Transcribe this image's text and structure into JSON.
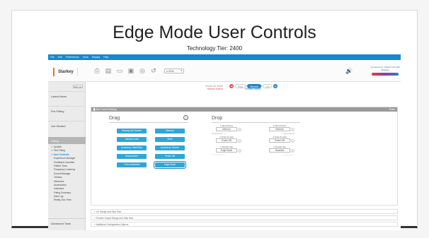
{
  "slide": {
    "title": "Edge Mode User Controls",
    "subtitle": "Technology Tier: 2400"
  },
  "menu": [
    "File",
    "Edit",
    "Preferences",
    "Tools",
    "Display",
    "Help"
  ],
  "toolbar": {
    "logo": "Starkey",
    "selector": "e-SEM",
    "connection": "Connected to: Patient  3.01 Wifi  Wireless",
    "icons": [
      "save-icon",
      "print-icon",
      "open-icon",
      "folder-icon",
      "record-icon",
      "undo-icon",
      "ear-icon",
      "music-icon"
    ]
  },
  "program": {
    "left_name": "Evolv AI 2400",
    "left_status": "Restart Switch",
    "right_name": "Evolv AI 2400",
    "right_status": "Restart Switch",
    "sides": [
      "Right",
      "Binaural",
      "Left"
    ],
    "selected_side": "Binaural"
  },
  "sidebar": {
    "edit_label": "Edit List",
    "sections": [
      "Latest News",
      "Pre-Fitting",
      "Get Started"
    ],
    "active": "Fitting",
    "items": [
      {
        "label": "Quickfit",
        "checked": true
      },
      {
        "label": "First Fitting",
        "checked": true
      },
      {
        "label": "User Controls",
        "checked": true,
        "selected": true
      },
      {
        "label": "Experience Manager"
      },
      {
        "label": "Feedback Canceller"
      },
      {
        "label": "Patient Tools"
      },
      {
        "label": "Frequency Lowering"
      },
      {
        "label": "Sound Manager"
      },
      {
        "label": "Tinnitus"
      },
      {
        "label": "Memories"
      },
      {
        "label": "Accessories"
      },
      {
        "label": "Indicators"
      },
      {
        "label": "Fitting Summary"
      },
      {
        "label": "Data Log"
      },
      {
        "label": "Really, Ear, Hear"
      }
    ],
    "advanced": "Advanced Tools"
  },
  "panel": {
    "header": "User Control Settings",
    "reset": "Reset",
    "drag_title": "Drag",
    "drop_title": "Drop",
    "drag_buttons": [
      "Hearing Aid Volume",
      "Memory",
      "Tinnitus Level",
      "Mute",
      "Accessory Start/Stop",
      "Accessory Volume",
      "Manual Alert",
      "Power Off",
      "Thrive Assistant",
      "Edge Mode"
    ],
    "drop": {
      "left": {
        "short_press_label": "Short Press",
        "short_press_value": "Memory",
        "up_down": "Up to Go",
        "push_hold_label": "Push & Hold",
        "push_hold_value": "Power Off",
        "double_tap_label": "Double Tap",
        "double_tap_value": "Edge Mode",
        "up_down2": "Up to Go"
      },
      "right": {
        "short_press_label": "Short Press",
        "short_press_value": "Memory",
        "up_down": "Up to Go",
        "push_hold_label": "Push & Hold",
        "push_hold_value": "Power Off",
        "double_tap_label": "Double Tap",
        "double_tap_value": "Disabled",
        "up_down2": "Up to Go"
      }
    }
  },
  "collapsed_panels": [
    "VC Range and Step Size",
    "Tinnitus Output Range and Step Size",
    "Additional Configuration Options"
  ]
}
